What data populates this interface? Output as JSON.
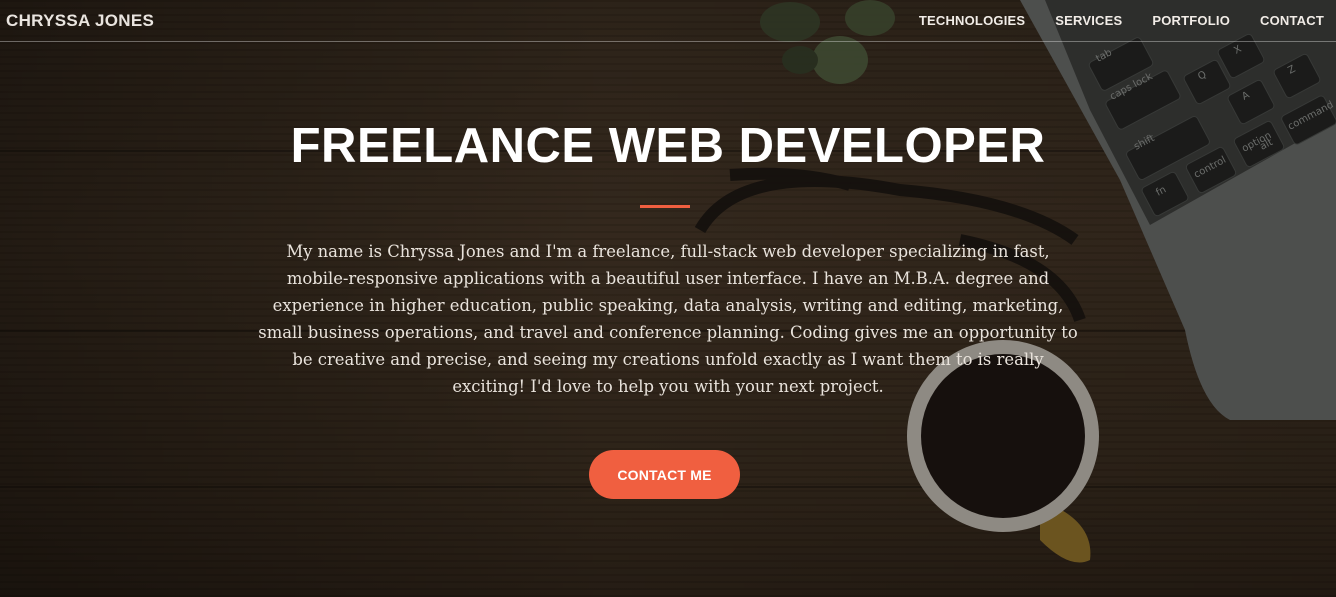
{
  "nav": {
    "brand": "CHRYSSA JONES",
    "items": [
      "TECHNOLOGIES",
      "SERVICES",
      "PORTFOLIO",
      "CONTACT"
    ]
  },
  "hero": {
    "title": "FREELANCE WEB DEVELOPER",
    "description": "My name is Chryssa Jones and I'm a freelance, full-stack web developer specializing in fast, mobile-responsive applications with a beautiful user interface. I have an M.B.A. degree and experience in higher education, public speaking, data analysis, writing and editing, marketing, small business operations, and travel and conference planning. Coding gives me an opportunity to be creative and precise, and seeing my creations unfold exactly as I want them to is really exciting! I'd love to help you with your next project.",
    "cta_label": "CONTACT ME"
  },
  "keyboard_keys": [
    "tab",
    "caps lock",
    "shift",
    "fn",
    "control",
    "option",
    "command",
    "Q",
    "A",
    "Z",
    "X",
    "alt"
  ],
  "colors": {
    "accent": "#f05f40",
    "nav_text": "#f1ece7",
    "body_text": "#e9e3dc"
  }
}
